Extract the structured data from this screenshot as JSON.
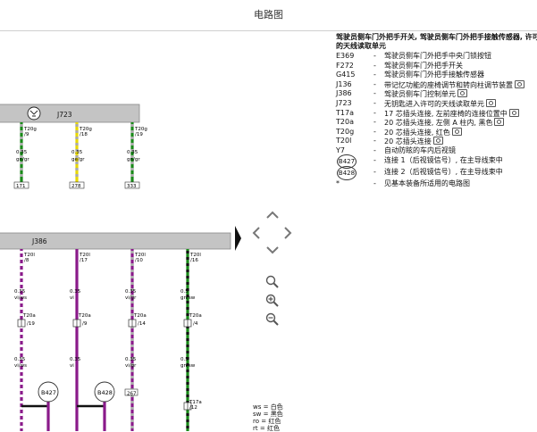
{
  "title": "电路图",
  "legend": {
    "heading": "驾驶员侧车门外把手开关, 驾驶员侧车门外把手接触传感器, 许可的天线读取单元",
    "items": [
      {
        "code": "E369",
        "desc": "驾驶员侧车门外把手中央门锁按钮",
        "cam": false
      },
      {
        "code": "F272",
        "desc": "驾驶员侧车门外把手开关",
        "cam": false
      },
      {
        "code": "G415",
        "desc": "驾驶员侧车门外把手接触传感器",
        "cam": false
      },
      {
        "code": "J136",
        "desc": "带记忆功能的座椅调节和转向柱调节装置",
        "cam": true
      },
      {
        "code": "J386",
        "desc": "驾驶员侧车门控制单元",
        "cam": true
      },
      {
        "code": "J723",
        "desc": "无钥匙进入许可的天线读取单元",
        "cam": true
      },
      {
        "code": "T17a",
        "desc": "17 芯插头连接, 左前座椅的连接位置中",
        "cam": true
      },
      {
        "code": "T20a",
        "desc": "20 芯插头连接, 左侧 A 柱内, 黑色",
        "cam": true
      },
      {
        "code": "T20g",
        "desc": "20 芯插头连接, 红色",
        "cam": true
      },
      {
        "code": "T20l",
        "desc": "20 芯插头连接",
        "cam": true
      },
      {
        "code": "Y7",
        "desc": "自动防眩的车内后视镜",
        "cam": false
      }
    ],
    "connections": [
      {
        "code": "B427",
        "desc": "连接 1（后视镜信号）, 在主导线束中"
      },
      {
        "code": "B428",
        "desc": "连接 2（后视镜信号）, 在主导线束中"
      }
    ],
    "note": {
      "code": "*",
      "desc": "见基本装备所适用的电路图"
    }
  },
  "diagram": {
    "module_j723": "J723",
    "module_j386": "J386",
    "j723_pins": [
      {
        "conn": "T20g",
        "pin": "/9",
        "gauge": "0.35",
        "color": "gn/gr",
        "ref": "171",
        "wire": "#1a8a1a",
        "stripe": "#aaaaaa"
      },
      {
        "conn": "T20g",
        "pin": "/18",
        "gauge": "0.35",
        "color": "ge/gr",
        "ref": "278",
        "wire": "#e8d800",
        "stripe": "#aaaaaa"
      },
      {
        "conn": "T20g",
        "pin": "/19",
        "gauge": "0.35",
        "color": "gn/gr",
        "ref": "333",
        "wire": "#1a8a1a",
        "stripe": "#aaaaaa"
      }
    ],
    "j386_pins": [
      {
        "conn": "T20l",
        "pin": "/8",
        "gauge1": "0.35",
        "color1": "vi/ws",
        "conn2": "T20a",
        "pin2": "/19",
        "gauge2": "0.35",
        "color2": "vi/ws",
        "wire": "#8a1a8a",
        "stripe": "#ffffff"
      },
      {
        "conn": "T20l",
        "pin": "/17",
        "gauge1": "0.35",
        "color1": "vi",
        "conn2": "T20a",
        "pin2": "/9",
        "gauge2": "0.35",
        "color2": "vi",
        "wire": "#8a1a8a",
        "stripe": ""
      },
      {
        "conn": "T20l",
        "pin": "/10",
        "gauge1": "0.35",
        "color1": "vi/gr",
        "conn2": "T20a",
        "pin2": "/14",
        "gauge2": "0.35",
        "color2": "vi/gr",
        "wire": "#8a1a8a",
        "stripe": "#aaaaaa"
      },
      {
        "conn": "T20l",
        "pin": "/16",
        "gauge1": "0.5",
        "color1": "gn/sw",
        "conn2": "T20a",
        "pin2": "/4",
        "gauge2": "0.5",
        "color2": "gn/sw",
        "wire": "#1a8a1a",
        "stripe": "#111111"
      }
    ],
    "junctions": [
      "B427",
      "B428"
    ],
    "ref_267": "267",
    "t17a": {
      "conn": "T17a",
      "pin": "/12"
    }
  },
  "color_key": [
    "ws = 白色",
    "sw = 黑色",
    "ro = 红色",
    "rt = 红色"
  ]
}
